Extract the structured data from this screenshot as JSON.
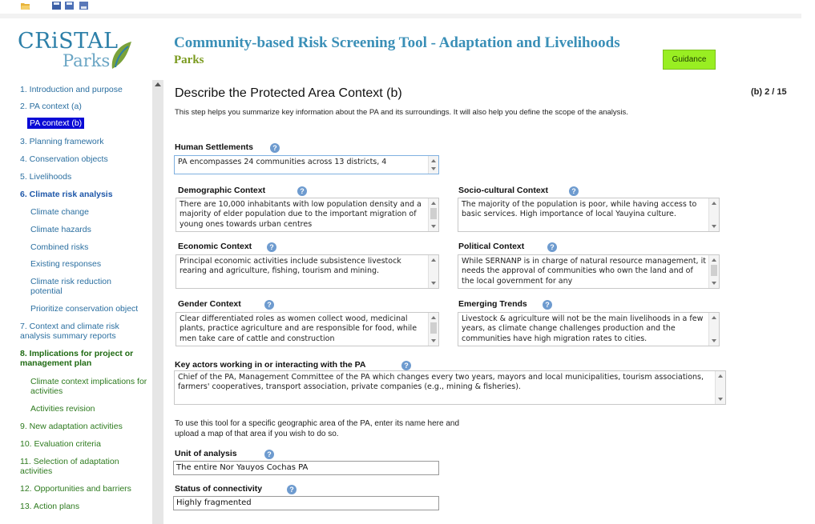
{
  "brand": {
    "line1": "CRiSTAL",
    "line2": "Parks"
  },
  "header": {
    "title": "Community-based Risk Screening Tool - Adaptation and Livelihoods",
    "subtitle": "Parks",
    "guidance_label": "Guidance"
  },
  "sidebar": {
    "items": [
      {
        "label": "1. Introduction and purpose"
      },
      {
        "label": "2. PA context (a)"
      },
      {
        "label": "PA context (b)"
      },
      {
        "label": "3. Planning framework"
      },
      {
        "label": "4. Conservation objects"
      },
      {
        "label": "5. Livelihoods"
      },
      {
        "label": "6. Climate risk analysis"
      },
      {
        "label": "Climate change"
      },
      {
        "label": "Climate hazards"
      },
      {
        "label": "Combined risks"
      },
      {
        "label": "Existing responses"
      },
      {
        "label": "Climate risk reduction potential"
      },
      {
        "label": "Prioritize conservation object"
      },
      {
        "label": "7. Context and climate risk analysis summary reports"
      },
      {
        "label": "8. Implications for project or management plan"
      },
      {
        "label": "Climate context implications for activities"
      },
      {
        "label": "Activities revision"
      },
      {
        "label": "9. New adaptation activities"
      },
      {
        "label": "10. Evaluation criteria"
      },
      {
        "label": "11. Selection of adaptation activities"
      },
      {
        "label": "12. Opportunities and barriers"
      },
      {
        "label": "13. Action plans"
      }
    ]
  },
  "main": {
    "title": "Describe the Protected Area Context (b)",
    "step_counter": "(b) 2 / 15",
    "intro": "This step helps you summarize key information about the PA and its surroundings. It will also help you define the scope of the analysis.",
    "info_glyph": "?",
    "fields": {
      "human_settlements": {
        "label": "Human Settlements",
        "value": "PA encompasses 24 communities across 13 districts, 4"
      },
      "demographic": {
        "label": "Demographic Context",
        "value": "There are 10,000 inhabitants with low population density and a majority of elder population due to the important migration of young ones towards urban centres"
      },
      "sociocultural": {
        "label": "Socio-cultural Context",
        "value": "The majority of the population is poor, while having access to basic services. High importance of local Yauyina culture."
      },
      "economic": {
        "label": "Economic Context",
        "value": "Principal economic activities include subsistence livestock rearing and agriculture, fishing, tourism and mining."
      },
      "political": {
        "label": "Political Context",
        "value": "While SERNANP is in charge of natural resource management, it needs the approval of communities who own the land and of the local government for any"
      },
      "gender": {
        "label": "Gender Context",
        "value": "Clear differentiated roles as women collect wood, medicinal plants, practice agriculture and are responsible for food, while men take care of cattle and construction"
      },
      "emerging": {
        "label": "Emerging Trends",
        "value": "Livestock & agriculture will not be the main livelihoods in a few years, as climate change challenges production and the communities have high migration rates to cities."
      },
      "key_actors": {
        "label": "Key actors working in or interacting with the PA",
        "value": "Chief of the PA, Management Committee of the PA which changes every two years, mayors and local municipalities, tourism associations, farmers' cooperatives, transport association, private companies (e.g., mining & fisheries)."
      }
    },
    "scope_note": "To use this tool for a specific geographic area of the PA, enter its name here and upload a map of that area if you wish to do so.",
    "unit": {
      "label": "Unit of analysis",
      "value": "The entire Nor Yauyos Cochas PA"
    },
    "connectivity": {
      "label": "Status of connectivity",
      "value": "Highly fragmented"
    }
  },
  "colors": {
    "accent_title": "#3a8fb7",
    "subtitle_green": "#7a9a1e",
    "guidance_bg": "#99ee22",
    "nav_blue": "#2b6fa0",
    "nav_active_bg": "#0a0ad6"
  },
  "icons": [
    "open-folder-icon",
    "save-icon",
    "save-all-icon",
    "print-icon",
    "leaf-logo-icon",
    "info-icon"
  ]
}
